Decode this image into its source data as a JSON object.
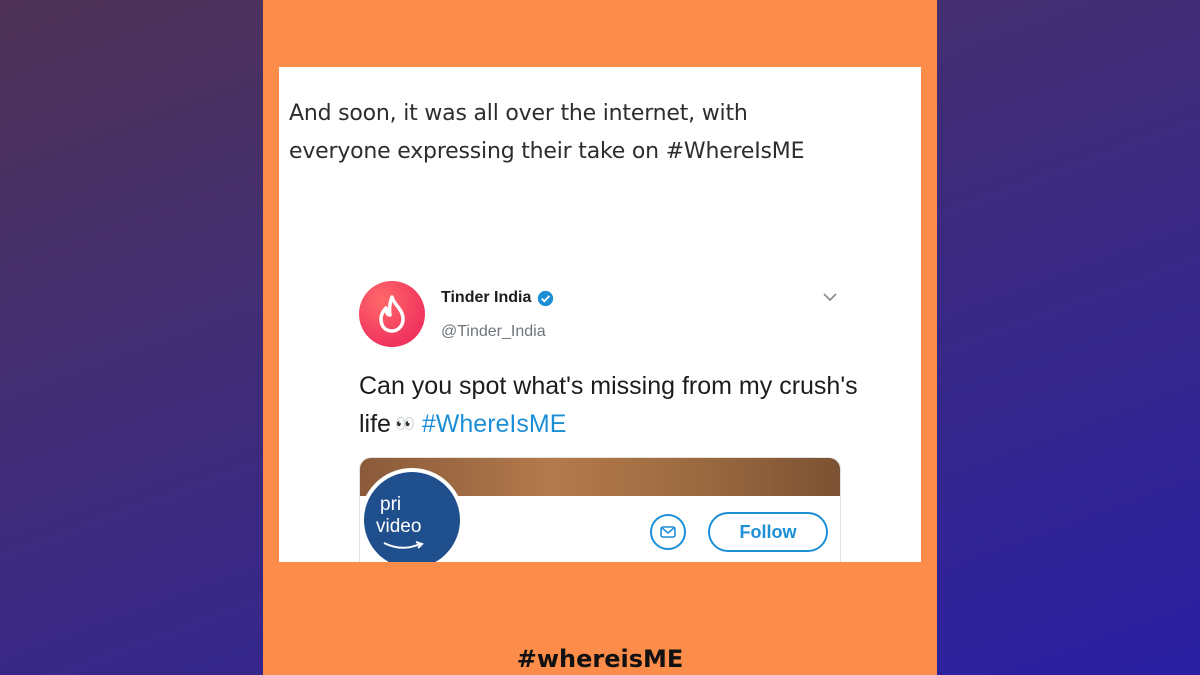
{
  "intro_text": "And soon, it was all over the internet, with\neveryone expressing their take on #WhereIsME",
  "tweet": {
    "account_name": "Tinder India",
    "handle": "@Tinder_India",
    "text": "Can you spot what's missing from my crush's life",
    "eyes_emoji": "👀",
    "hashtag": "#WhereIsME"
  },
  "embedded_card": {
    "logo_line1": "pri",
    "logo_line2": "video",
    "follow_label": "Follow"
  },
  "footer_hashtag": "#whereisME",
  "colors": {
    "panel": "#fb8c49",
    "tinder_brand": "#f0345e",
    "link_blue": "#1d8fd6",
    "prime_blue": "#1f4f8c"
  },
  "icons": [
    "tinder-flame-icon",
    "verified-badge-icon",
    "chevron-down-icon",
    "mail-icon",
    "amazon-smile-icon"
  ]
}
